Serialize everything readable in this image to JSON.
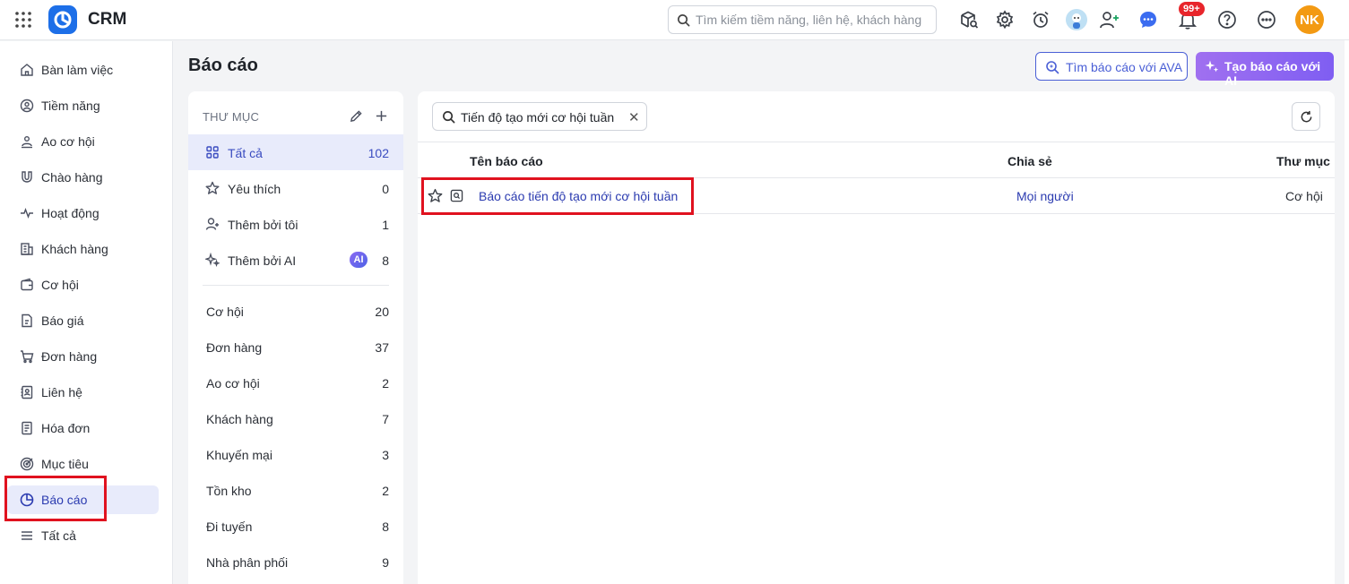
{
  "header": {
    "app_title": "CRM",
    "search_placeholder": "Tìm kiếm tiềm năng, liên hệ, khách hàng",
    "notification_count": "99+",
    "user_initials": "NK",
    "brand_color": "#1d6fe8"
  },
  "sidebar": {
    "items": [
      {
        "label": "Bàn làm việc",
        "icon": "home-icon"
      },
      {
        "label": "Tiềm năng",
        "icon": "target-person-icon"
      },
      {
        "label": "Ao cơ hội",
        "icon": "pool-icon"
      },
      {
        "label": "Chào hàng",
        "icon": "magnet-icon"
      },
      {
        "label": "Hoạt động",
        "icon": "activity-icon"
      },
      {
        "label": "Khách hàng",
        "icon": "building-icon"
      },
      {
        "label": "Cơ hội",
        "icon": "wallet-icon"
      },
      {
        "label": "Báo giá",
        "icon": "quote-icon"
      },
      {
        "label": "Đơn hàng",
        "icon": "cart-icon"
      },
      {
        "label": "Liên hệ",
        "icon": "contact-book-icon"
      },
      {
        "label": "Hóa đơn",
        "icon": "invoice-icon"
      },
      {
        "label": "Mục tiêu",
        "icon": "goal-icon"
      },
      {
        "label": "Báo cáo",
        "icon": "pie-chart-icon",
        "active": true
      },
      {
        "label": "Tất cả",
        "icon": "menu-lines-icon"
      }
    ]
  },
  "page": {
    "title": "Báo cáo",
    "find_with_ava_label": "Tìm báo cáo với AVA",
    "create_with_ai_label": "Tạo báo cáo với AI"
  },
  "folders": {
    "title": "THƯ MỤC",
    "quick": [
      {
        "label": "Tất cả",
        "count": "102",
        "icon": "grid-icon",
        "active": true
      },
      {
        "label": "Yêu thích",
        "count": "0",
        "icon": "star-icon"
      },
      {
        "label": "Thêm bởi tôi",
        "count": "1",
        "icon": "user-add-icon"
      },
      {
        "label": "Thêm bởi AI",
        "count": "8",
        "icon": "sparkle-icon",
        "badge": "AI"
      }
    ],
    "categories": [
      {
        "label": "Cơ hội",
        "count": "20"
      },
      {
        "label": "Đơn hàng",
        "count": "37"
      },
      {
        "label": "Ao cơ hội",
        "count": "2"
      },
      {
        "label": "Khách hàng",
        "count": "7"
      },
      {
        "label": "Khuyến mại",
        "count": "3"
      },
      {
        "label": "Tồn kho",
        "count": "2"
      },
      {
        "label": "Đi tuyến",
        "count": "8"
      },
      {
        "label": "Nhà phân phối",
        "count": "9"
      }
    ]
  },
  "reports": {
    "search_value": "Tiến độ tạo mới cơ hội tuần",
    "columns": {
      "name": "Tên báo cáo",
      "share": "Chia sẻ",
      "folder": "Thư mục"
    },
    "rows": [
      {
        "name": "Báo cáo tiến độ tạo mới cơ hội tuần",
        "share": "Mọi người",
        "folder": "Cơ hội"
      }
    ]
  }
}
